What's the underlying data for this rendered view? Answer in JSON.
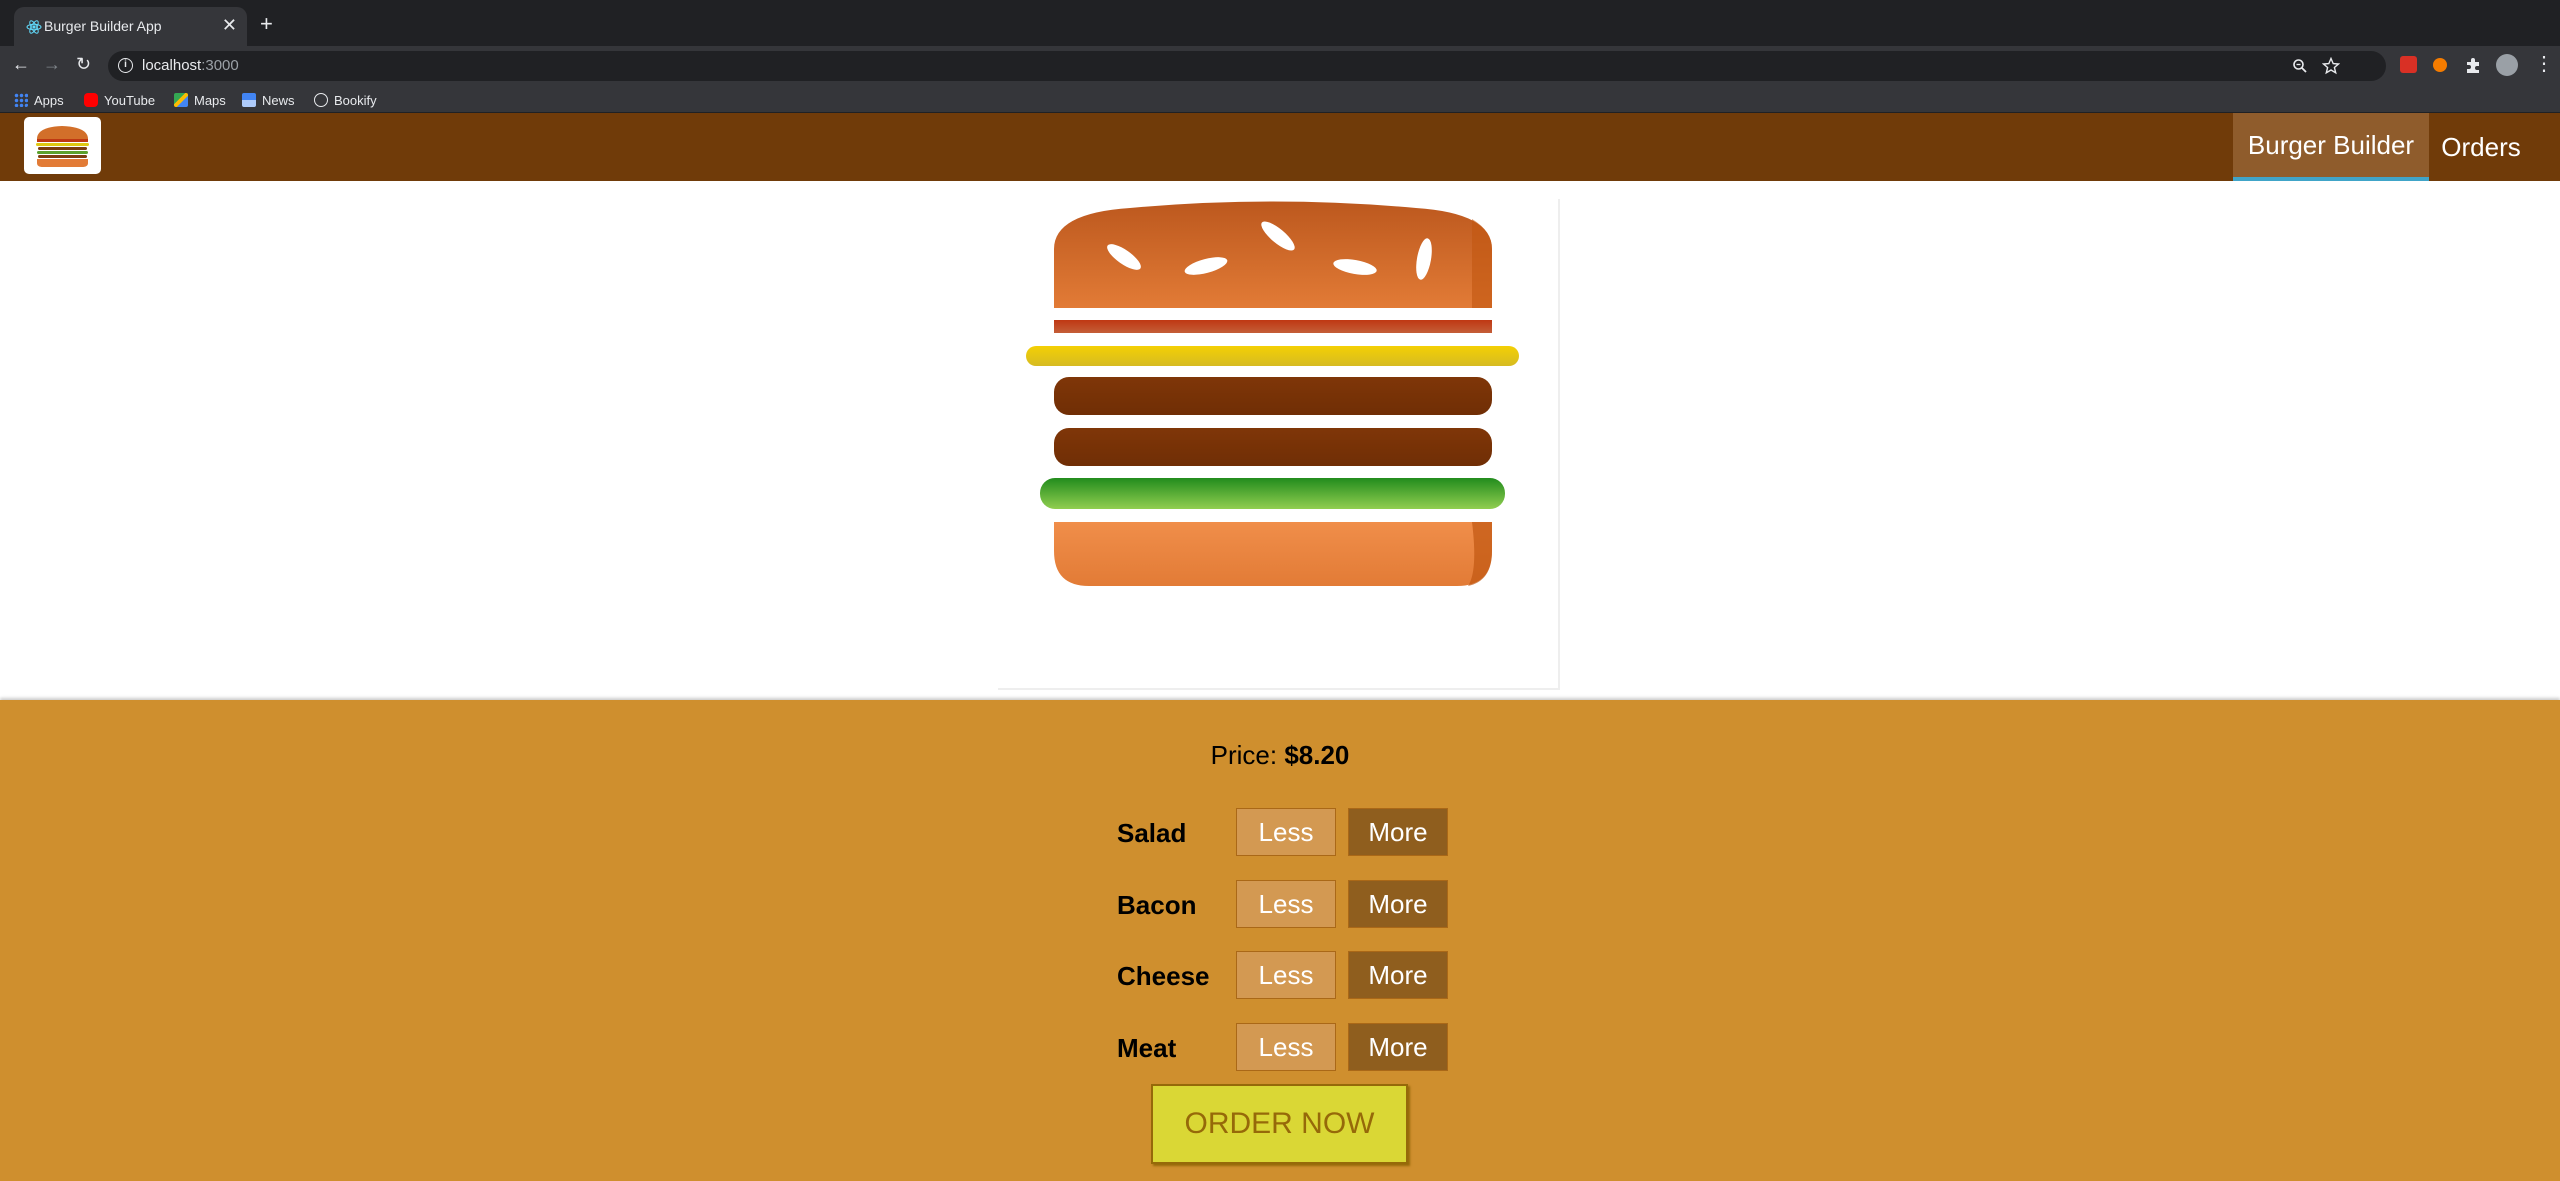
{
  "browser": {
    "tab_title": "Burger Builder App",
    "tab_close": "✕",
    "new_tab": "+",
    "url_host": "localhost",
    "url_port": ":3000",
    "back": "←",
    "forward": "→",
    "reload": "↻",
    "bookmarks": [
      {
        "label": "Apps",
        "icon": "apps-grid-icon"
      },
      {
        "label": "YouTube",
        "icon": "youtube-icon"
      },
      {
        "label": "Maps",
        "icon": "maps-icon"
      },
      {
        "label": "News",
        "icon": "news-icon"
      },
      {
        "label": "Bookify",
        "icon": "globe-icon"
      }
    ]
  },
  "header": {
    "nav": [
      {
        "label": "Burger Builder",
        "active": true
      },
      {
        "label": "Orders",
        "active": false
      }
    ]
  },
  "burger": {
    "layers": [
      "bread-top",
      "bacon",
      "cheese",
      "meat",
      "meat",
      "salad",
      "bread-bottom"
    ]
  },
  "controls": {
    "price_label": "Price:",
    "price_value": "$8.20",
    "rows": [
      {
        "label": "Salad",
        "less": "Less",
        "more": "More"
      },
      {
        "label": "Bacon",
        "less": "Less",
        "more": "More"
      },
      {
        "label": "Cheese",
        "less": "Less",
        "more": "More"
      },
      {
        "label": "Meat",
        "less": "Less",
        "more": "More"
      }
    ],
    "order_button": "ORDER NOW"
  },
  "colors": {
    "header": "#703b09",
    "controls_bg": "#cf8f2e",
    "order_button": "#dad735",
    "active_nav_underline": "#40a4c8"
  }
}
